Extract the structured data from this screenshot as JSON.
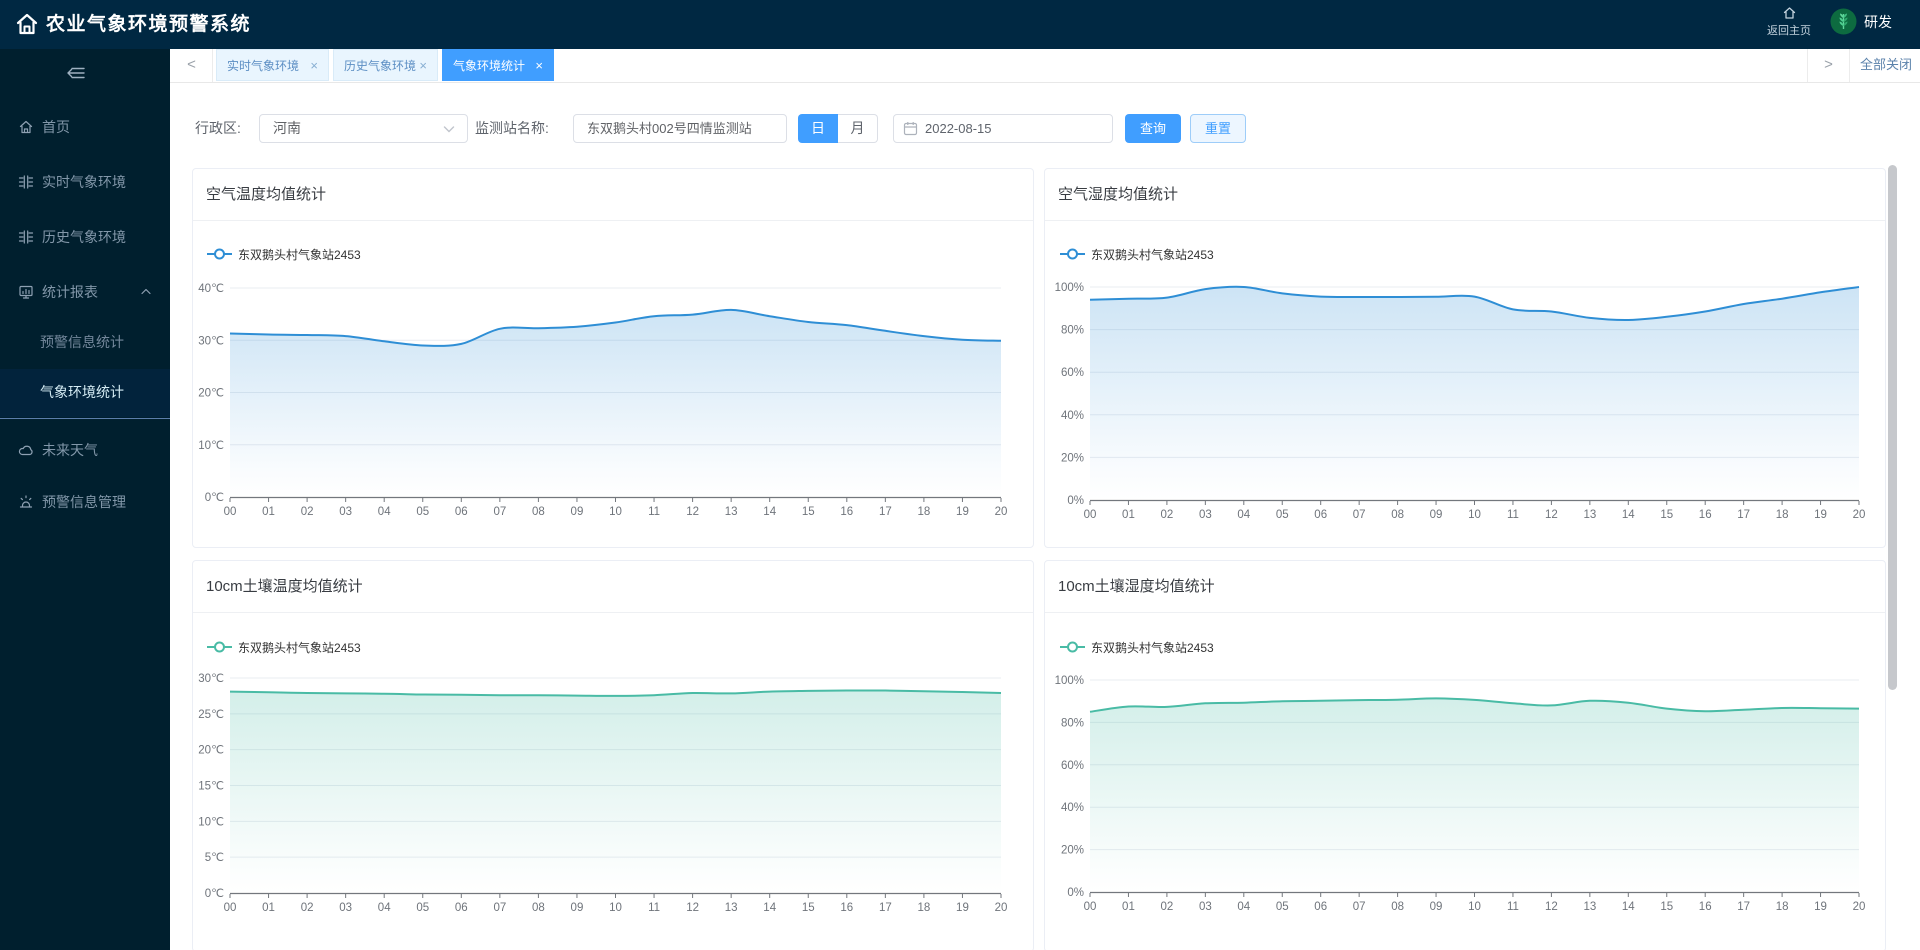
{
  "header": {
    "title": "农业气象环境预警系统",
    "home_link": "返回主页",
    "user_name": "研发"
  },
  "sidebar": {
    "items": [
      {
        "label": "首页"
      },
      {
        "label": "实时气象环境"
      },
      {
        "label": "历史气象环境"
      },
      {
        "label": "统计报表",
        "expanded": true,
        "children": [
          {
            "label": "预警信息统计"
          },
          {
            "label": "气象环境统计",
            "active": true
          }
        ]
      },
      {
        "label": "未来天气"
      },
      {
        "label": "预警信息管理"
      }
    ]
  },
  "tabbar": {
    "tabs": [
      {
        "label": "实时气象环境",
        "active": false
      },
      {
        "label": "历史气象环境",
        "active": false
      },
      {
        "label": "气象环境统计",
        "active": true
      }
    ],
    "close_label": "×",
    "close_all": "全部关闭"
  },
  "filter": {
    "region_label": "行政区:",
    "region_value": "河南",
    "station_label": "监测站名称:",
    "station_value": "东双鹅头村002号四情监测站",
    "day_label": "日",
    "month_label": "月",
    "date_value": "2022-08-15",
    "query_label": "查询",
    "reset_label": "重置"
  },
  "chart_data": [
    {
      "type": "line",
      "title": "空气温度均值统计",
      "categories": [
        "00",
        "01",
        "02",
        "03",
        "04",
        "05",
        "06",
        "07",
        "08",
        "09",
        "10",
        "11",
        "12",
        "13",
        "14",
        "15",
        "16",
        "17",
        "18",
        "19",
        "20"
      ],
      "series": [
        {
          "name": "东双鹅头村气象站2453",
          "values": [
            31.3,
            31.1,
            31.0,
            30.8,
            29.8,
            29.0,
            29.3,
            32.2,
            32.3,
            32.6,
            33.4,
            34.6,
            34.9,
            35.8,
            34.6,
            33.5,
            32.9,
            31.8,
            30.8,
            30.1,
            29.9
          ]
        }
      ],
      "ylim": [
        0,
        40
      ],
      "y_step": 10,
      "unit": "℃",
      "color": "#2e8ed5",
      "grid": true,
      "legend_position": "top-left"
    },
    {
      "type": "line",
      "title": "空气湿度均值统计",
      "categories": [
        "00",
        "01",
        "02",
        "03",
        "04",
        "05",
        "06",
        "07",
        "08",
        "09",
        "10",
        "11",
        "12",
        "13",
        "14",
        "15",
        "16",
        "17",
        "18",
        "19",
        "20"
      ],
      "series": [
        {
          "name": "东双鹅头村气象站2453",
          "values": [
            94,
            94.5,
            95,
            99,
            100,
            97,
            95.5,
            95.3,
            95.3,
            95.4,
            95.5,
            89.5,
            88.5,
            85.5,
            84.5,
            86,
            88.5,
            92,
            94.5,
            97.5,
            100
          ]
        }
      ],
      "ylim": [
        0,
        100
      ],
      "y_step": 20,
      "unit": "%",
      "color": "#2e8ed5",
      "grid": true,
      "legend_position": "top-left"
    },
    {
      "type": "line",
      "title": "10cm土壤温度均值统计",
      "categories": [
        "00",
        "01",
        "02",
        "03",
        "04",
        "05",
        "06",
        "07",
        "08",
        "09",
        "10",
        "11",
        "12",
        "13",
        "14",
        "15",
        "16",
        "17",
        "18",
        "19",
        "20"
      ],
      "series": [
        {
          "name": "东双鹅头村气象站2453",
          "values": [
            28.1,
            28.0,
            27.9,
            27.85,
            27.8,
            27.7,
            27.65,
            27.6,
            27.6,
            27.55,
            27.5,
            27.6,
            27.9,
            27.85,
            28.1,
            28.2,
            28.25,
            28.25,
            28.15,
            28.05,
            27.9
          ]
        }
      ],
      "ylim": [
        0,
        30
      ],
      "y_step": 5,
      "unit": "℃",
      "color": "#49bba5",
      "grid": true,
      "legend_position": "top-left"
    },
    {
      "type": "line",
      "title": "10cm土壤湿度均值统计",
      "categories": [
        "00",
        "01",
        "02",
        "03",
        "04",
        "05",
        "06",
        "07",
        "08",
        "09",
        "10",
        "11",
        "12",
        "13",
        "14",
        "15",
        "16",
        "17",
        "18",
        "19",
        "20"
      ],
      "series": [
        {
          "name": "东双鹅头村气象站2453",
          "values": [
            85,
            87.5,
            87.3,
            89,
            89.3,
            90,
            90.2,
            90.5,
            90.7,
            91.3,
            90.6,
            89,
            88,
            90.2,
            89.3,
            86.5,
            85.3,
            86,
            86.8,
            86.7,
            86.5
          ]
        }
      ],
      "ylim": [
        0,
        100
      ],
      "y_step": 20,
      "unit": "%",
      "color": "#49bba5",
      "grid": true,
      "legend_position": "top-left"
    }
  ]
}
